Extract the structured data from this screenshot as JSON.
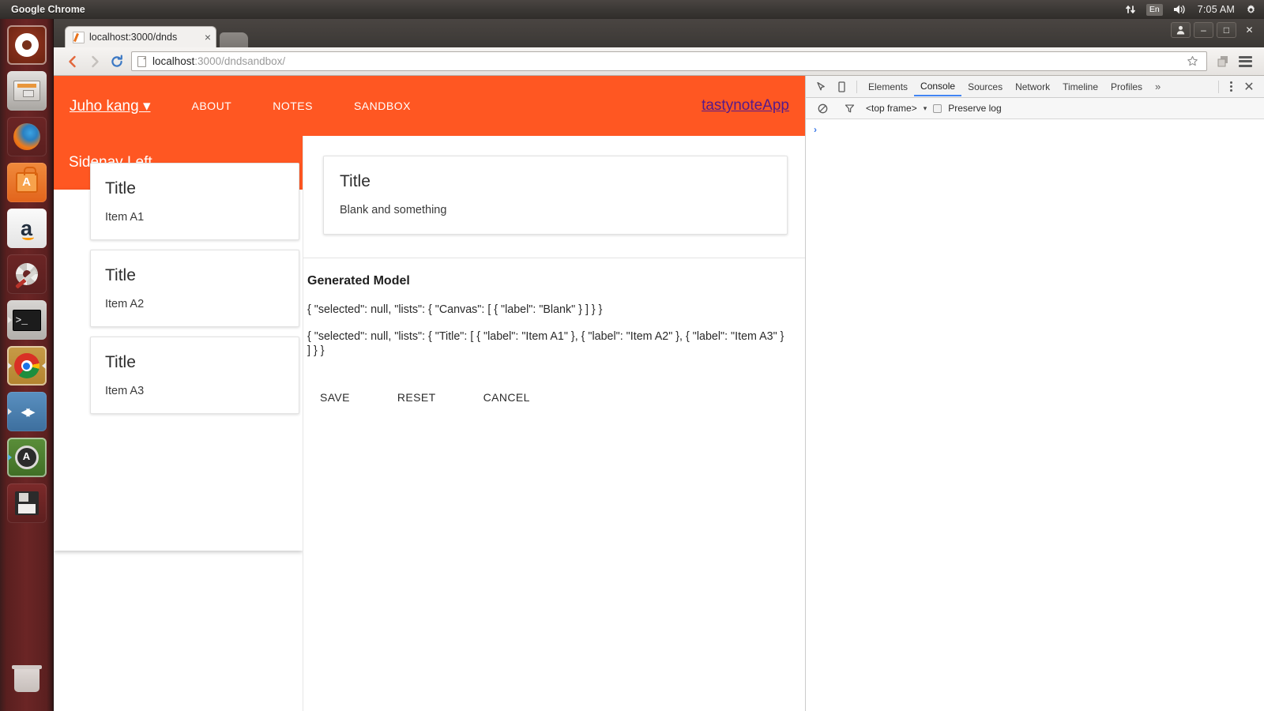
{
  "ubuntu_panel": {
    "app_name": "Google Chrome",
    "tray": {
      "network_icon": "network-transfer-icon",
      "keyboard_layout": "En",
      "volume_icon": "volume-icon",
      "clock": "7:05 AM",
      "gear_icon": "system-gear-icon"
    }
  },
  "launcher": {
    "items": [
      {
        "name": "ubuntu-dash",
        "icon": "ubuntu-logo-icon"
      },
      {
        "name": "files",
        "icon": "file-manager-icon"
      },
      {
        "name": "firefox",
        "icon": "firefox-icon"
      },
      {
        "name": "ubuntu-software",
        "icon": "software-center-icon"
      },
      {
        "name": "amazon",
        "icon": "amazon-icon"
      },
      {
        "name": "system-settings",
        "icon": "settings-gear-icon"
      },
      {
        "name": "terminal",
        "icon": "terminal-icon"
      },
      {
        "name": "google-chrome",
        "icon": "chrome-icon"
      },
      {
        "name": "visual-studio",
        "icon": "visual-studio-icon"
      },
      {
        "name": "software-updater",
        "icon": "update-manager-icon"
      },
      {
        "name": "disk-image",
        "icon": "floppy-disk-icon"
      },
      {
        "name": "trash",
        "icon": "trash-icon"
      }
    ]
  },
  "chrome": {
    "window_buttons": {
      "profile": "person-icon",
      "minimize": "–",
      "maximize": "□",
      "close": "✕"
    },
    "tab": {
      "title": "localhost:3000/dnds",
      "close_label": "×",
      "favicon": "page-edit-icon"
    },
    "new_tab_label": "new-tab",
    "toolbar": {
      "back_icon": "back-arrow-icon",
      "forward_icon": "forward-arrow-icon",
      "reload_icon": "reload-icon",
      "page_icon": "page-icon",
      "url_host": "localhost",
      "url_path": ":3000/dndsandbox/",
      "url_full": "localhost:3000/dndsandbox/",
      "star_icon": "bookmark-star-icon",
      "extension_icon": "extension-icon",
      "menu_icon": "chrome-menu-icon"
    }
  },
  "app": {
    "toolbar": {
      "user_menu": "Juho kang ▾",
      "nav_links": [
        "ABOUT",
        "NOTES",
        "SANDBOX"
      ],
      "brand_link": "tastynoteApp",
      "background_color": "#FF5722"
    },
    "sidenav": {
      "title": "Sidenav Left",
      "cards": [
        {
          "title": "Title",
          "body": "Item A1"
        },
        {
          "title": "Title",
          "body": "Item A2"
        },
        {
          "title": "Title",
          "body": "Item A3"
        }
      ]
    },
    "canvas": {
      "card": {
        "title": "Title",
        "body": "Blank and something"
      }
    },
    "model": {
      "heading": "Generated Model",
      "lines": [
        "{ \"selected\": null, \"lists\": { \"Canvas\": [ { \"label\": \"Blank\" } ] } }",
        "{ \"selected\": null, \"lists\": { \"Title\": [ { \"label\": \"Item A1\" }, { \"label\": \"Item A2\" }, { \"label\": \"Item A3\" } ] } }"
      ]
    },
    "actions": [
      {
        "name": "save-button",
        "label": "SAVE"
      },
      {
        "name": "reset-button",
        "label": "RESET"
      },
      {
        "name": "cancel-button",
        "label": "CANCEL"
      }
    ]
  },
  "devtools": {
    "inspect_icon": "inspect-element-icon",
    "device_icon": "device-toolbar-icon",
    "tabs": [
      {
        "label": "Elements",
        "active": false
      },
      {
        "label": "Console",
        "active": true
      },
      {
        "label": "Sources",
        "active": false
      },
      {
        "label": "Network",
        "active": false
      },
      {
        "label": "Timeline",
        "active": false
      },
      {
        "label": "Profiles",
        "active": false
      }
    ],
    "more_tabs": "»",
    "kebab_icon": "more-options-icon",
    "close_label": "✕",
    "filterbar": {
      "clear_icon": "clear-console-icon",
      "filter_icon": "filter-icon",
      "frame_select": "<top frame>",
      "frame_caret": "▾",
      "preserve_log_label": "Preserve log",
      "preserve_log_checked": false
    },
    "console_prompt": "›"
  }
}
